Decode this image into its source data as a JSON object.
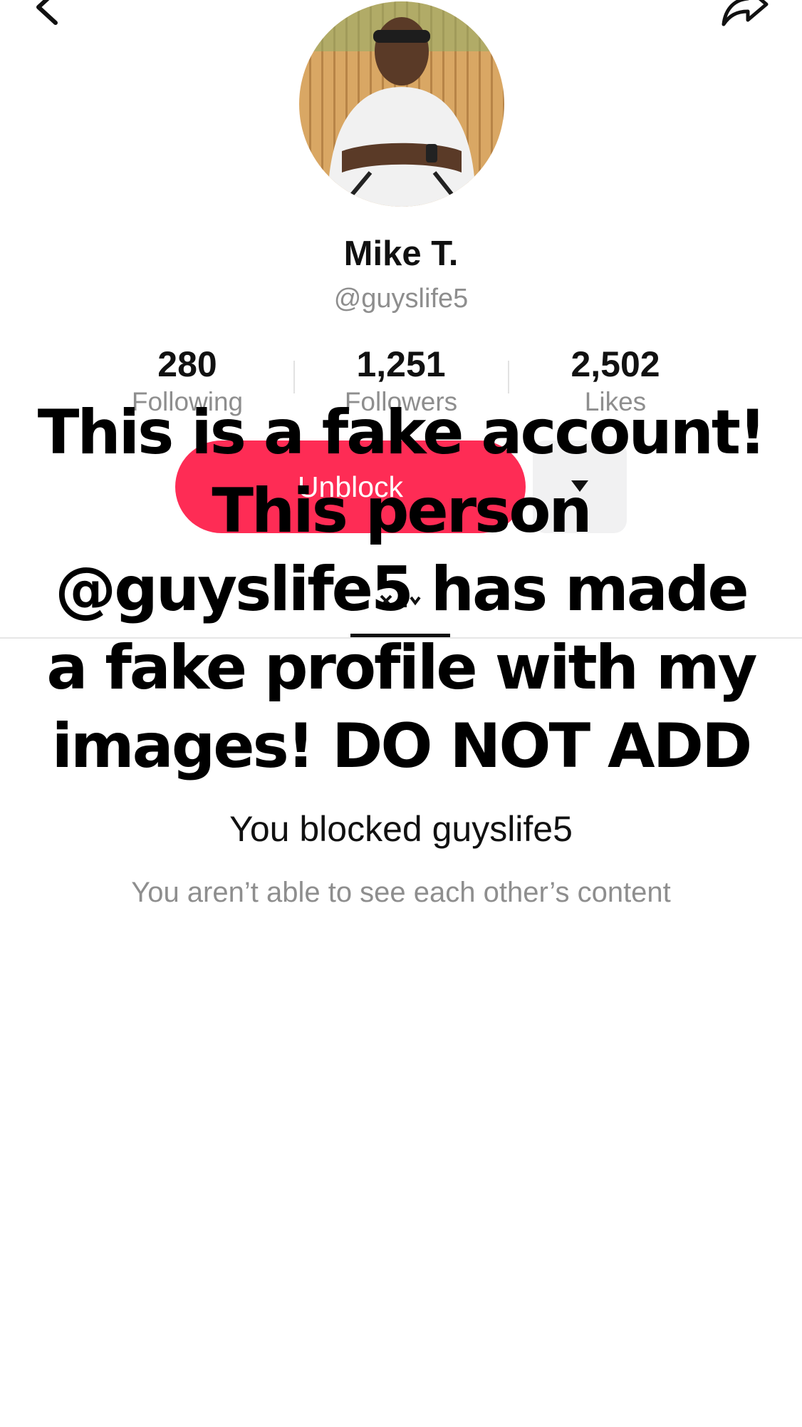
{
  "profile": {
    "display_name": "Mike T.",
    "handle": "@guyslife5",
    "avatar_alt": "Profile photo"
  },
  "stats": [
    {
      "value": "280",
      "label": "Following"
    },
    {
      "value": "1,251",
      "label": "Followers"
    },
    {
      "value": "2,502",
      "label": "Likes"
    }
  ],
  "actions": {
    "unblock_label": "Unblock"
  },
  "overlay": {
    "caption": "This is a fake account! This person @guyslife5 has made a fake profile with my images! DO NOT ADD"
  },
  "blocked": {
    "title": "You blocked guyslife5",
    "subtitle": "You aren’t able to see each other’s content"
  },
  "colors": {
    "accent": "#fe2c55",
    "secondary_text": "#8e8e8e"
  }
}
